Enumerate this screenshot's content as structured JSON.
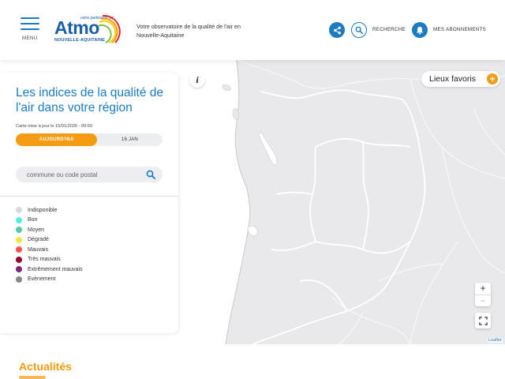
{
  "header": {
    "menu_label": "MENU",
    "logo": {
      "wordmark": "Atmo",
      "tagline": "votre partenaire air",
      "region": "NOUVELLE-AQUITAINE"
    },
    "tagline": "Votre observatoire de la qualité de l'air en Nouvelle-Aquitaine",
    "recherche_label": "RECHERCHE",
    "abonnements_label": "MES ABONNEMENTS",
    "icons": {
      "share": "share-icon",
      "search": "search-icon",
      "bell": "bell-icon"
    }
  },
  "panel": {
    "title": "Les indices de la qualité de l'air dans votre région",
    "update_text": "Carte mise à jour le 15/01/2026 - 09:50",
    "tabs": [
      {
        "label": "AUJOURD'HUI",
        "active": true
      },
      {
        "label": "16 JAN",
        "active": false
      }
    ],
    "search": {
      "placeholder": "commune ou code postal",
      "value": ""
    },
    "legend": [
      {
        "label": "Indisponible",
        "color": "#d9d9d9"
      },
      {
        "label": "Bon",
        "color": "#50f0e6"
      },
      {
        "label": "Moyen",
        "color": "#50ccaa"
      },
      {
        "label": "Dégradé",
        "color": "#f0e641"
      },
      {
        "label": "Mauvais",
        "color": "#ff5050"
      },
      {
        "label": "Très mauvais",
        "color": "#960032"
      },
      {
        "label": "Extrêmement mauvais",
        "color": "#872181"
      },
      {
        "label": "Evènement",
        "color": "#888888"
      }
    ]
  },
  "map": {
    "info_label": "i",
    "favoris_label": "Lieux favoris",
    "favoris_plus": "+",
    "zoom_in": "+",
    "zoom_out": "−",
    "attribution": "Leaflet"
  },
  "news": {
    "title": "Actualités"
  },
  "colors": {
    "primary": "#1b7cc1",
    "accent": "#f39c12",
    "map_land": "#e9e9eb"
  }
}
